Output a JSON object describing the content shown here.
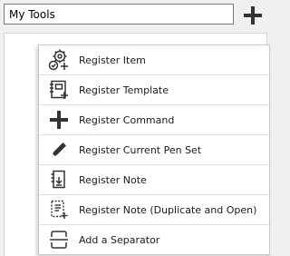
{
  "toolbar": {
    "name_value": "My Tools",
    "add_icon": "plus-icon"
  },
  "menu": {
    "items": [
      {
        "label": "Register Item",
        "icon": "gear-add-icon"
      },
      {
        "label": "Register Template",
        "icon": "template-icon"
      },
      {
        "label": "Register Command",
        "icon": "plus-icon"
      },
      {
        "label": "Register Current Pen Set",
        "icon": "pen-icon"
      },
      {
        "label": "Register Note",
        "icon": "note-icon"
      },
      {
        "label": "Register Note (Duplicate and Open)",
        "icon": "note-duplicate-icon"
      },
      {
        "label": "Add a Separator",
        "icon": "separator-icon"
      }
    ]
  },
  "colors": {
    "icon": "#333333",
    "border": "#c9c9c9"
  }
}
